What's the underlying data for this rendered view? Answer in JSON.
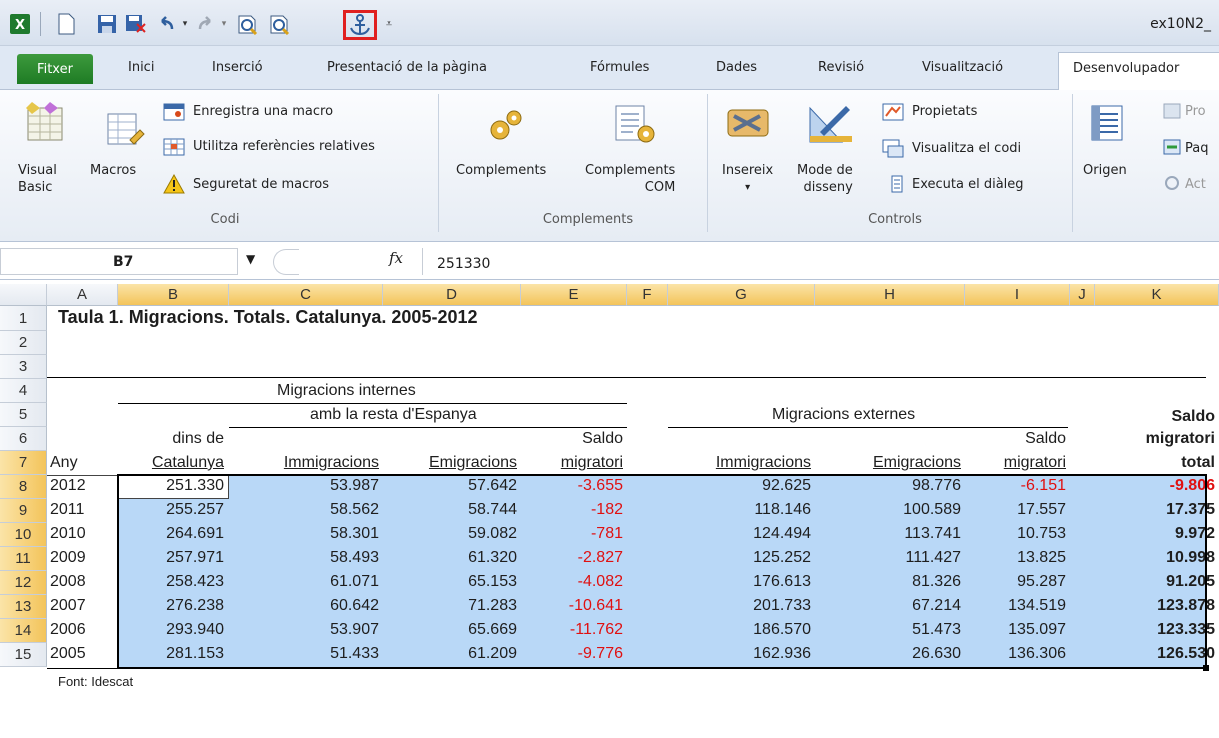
{
  "window": {
    "title": "ex10N2_"
  },
  "ribbon_tabs": [
    "Fitxer",
    "Inici",
    "Inserció",
    "Presentació de la pàgina",
    "Fórmules",
    "Dades",
    "Revisió",
    "Visualització",
    "Desenvolupador"
  ],
  "ribbon": {
    "codi": {
      "label": "Codi",
      "visual_basic": [
        "Visual",
        "Basic"
      ],
      "macros": "Macros",
      "record_macro": "Enregistra una macro",
      "relative_refs": "Utilitza referències relatives",
      "macro_security": "Seguretat de macros"
    },
    "complements": {
      "label": "Complements",
      "addins": "Complements",
      "com_addins": [
        "Complements",
        "COM"
      ]
    },
    "controls": {
      "label": "Controls",
      "insert": "Insereix",
      "design_mode": [
        "Mode de",
        "disseny"
      ],
      "properties": "Propietats",
      "view_code": "Visualitza el codi",
      "run_dialog": "Executa el diàleg"
    },
    "xml": {
      "source": "Origen",
      "p1": "Pro",
      "p2": "Paq",
      "p3": "Act"
    }
  },
  "formula_bar": {
    "name_box": "B7",
    "fx": "fx",
    "formula": "251330"
  },
  "columns": [
    "A",
    "B",
    "C",
    "D",
    "E",
    "F",
    "G",
    "H",
    "I",
    "J",
    "K"
  ],
  "rows": [
    "1",
    "2",
    "3",
    "4",
    "5",
    "6",
    "7",
    "8",
    "9",
    "10",
    "11",
    "12",
    "13",
    "14",
    "15"
  ],
  "sheet": {
    "title": "Taula 1. Migracions. Totals. Catalunya. 2005-2012",
    "h_internes": "Migracions internes",
    "h_resta": "amb la resta d'Espanya",
    "h_externes": "Migracions externes",
    "h_dins": "dins de",
    "h_saldo1": "Saldo",
    "h_saldo2": "Saldo",
    "h_saldo_total1": "Saldo",
    "h_saldo_total2": "migratori",
    "h_any": "Any",
    "h_catalunya": "Catalunya",
    "h_imm1": "Immigracions",
    "h_emi1": "Emigracions",
    "h_migratori1": "migratori",
    "h_imm2": "Immigracions",
    "h_emi2": "Emigracions",
    "h_migratori2": "migratori",
    "h_total": "total",
    "footer": "Font: Idescat",
    "data": [
      {
        "any": "2012",
        "dins": "251.330",
        "imm": "53.987",
        "emi": "57.642",
        "saldo": "-3.655",
        "ximm": "92.625",
        "xemi": "98.776",
        "xsaldo": "-6.151",
        "total": "-9.806"
      },
      {
        "any": "2011",
        "dins": "255.257",
        "imm": "58.562",
        "emi": "58.744",
        "saldo": "-182",
        "ximm": "118.146",
        "xemi": "100.589",
        "xsaldo": "17.557",
        "total": "17.375"
      },
      {
        "any": "2010",
        "dins": "264.691",
        "imm": "58.301",
        "emi": "59.082",
        "saldo": "-781",
        "ximm": "124.494",
        "xemi": "113.741",
        "xsaldo": "10.753",
        "total": "9.972"
      },
      {
        "any": "2009",
        "dins": "257.971",
        "imm": "58.493",
        "emi": "61.320",
        "saldo": "-2.827",
        "ximm": "125.252",
        "xemi": "111.427",
        "xsaldo": "13.825",
        "total": "10.998"
      },
      {
        "any": "2008",
        "dins": "258.423",
        "imm": "61.071",
        "emi": "65.153",
        "saldo": "-4.082",
        "ximm": "176.613",
        "xemi": "81.326",
        "xsaldo": "95.287",
        "total": "91.205"
      },
      {
        "any": "2007",
        "dins": "276.238",
        "imm": "60.642",
        "emi": "71.283",
        "saldo": "-10.641",
        "ximm": "201.733",
        "xemi": "67.214",
        "xsaldo": "134.519",
        "total": "123.878"
      },
      {
        "any": "2006",
        "dins": "293.940",
        "imm": "53.907",
        "emi": "65.669",
        "saldo": "-11.762",
        "ximm": "186.570",
        "xemi": "51.473",
        "xsaldo": "135.097",
        "total": "123.335"
      },
      {
        "any": "2005",
        "dins": "281.153",
        "imm": "51.433",
        "emi": "61.209",
        "saldo": "-9.776",
        "ximm": "162.936",
        "xemi": "26.630",
        "xsaldo": "136.306",
        "total": "126.530"
      }
    ]
  },
  "colors": {
    "selection": "#b9d8f7",
    "negative": "#e01010",
    "highlight_border": "#e02020"
  }
}
